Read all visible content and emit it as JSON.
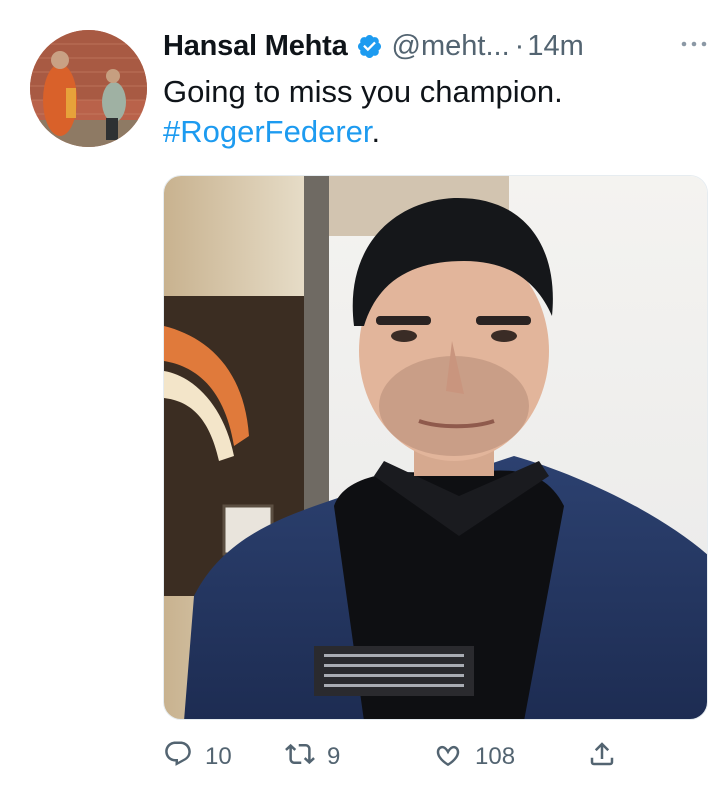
{
  "tweet": {
    "author_name": "Hansal Mehta",
    "handle": "@meht...",
    "separator": "·",
    "time": "14m",
    "text_line": "Going to miss you champion.",
    "hashtag": "#RogerFederer",
    "hashtag_suffix": "."
  },
  "actions": {
    "reply_count": "10",
    "retweet_count": "9",
    "like_count": "108"
  },
  "icons": {
    "verified": "verified-badge-icon",
    "more": "more-options-icon",
    "reply": "reply-icon",
    "retweet": "retweet-icon",
    "like": "heart-icon",
    "share": "share-icon"
  },
  "colors": {
    "accent": "#1d9bf0",
    "text_primary": "#0f1419",
    "text_secondary": "#536471"
  }
}
